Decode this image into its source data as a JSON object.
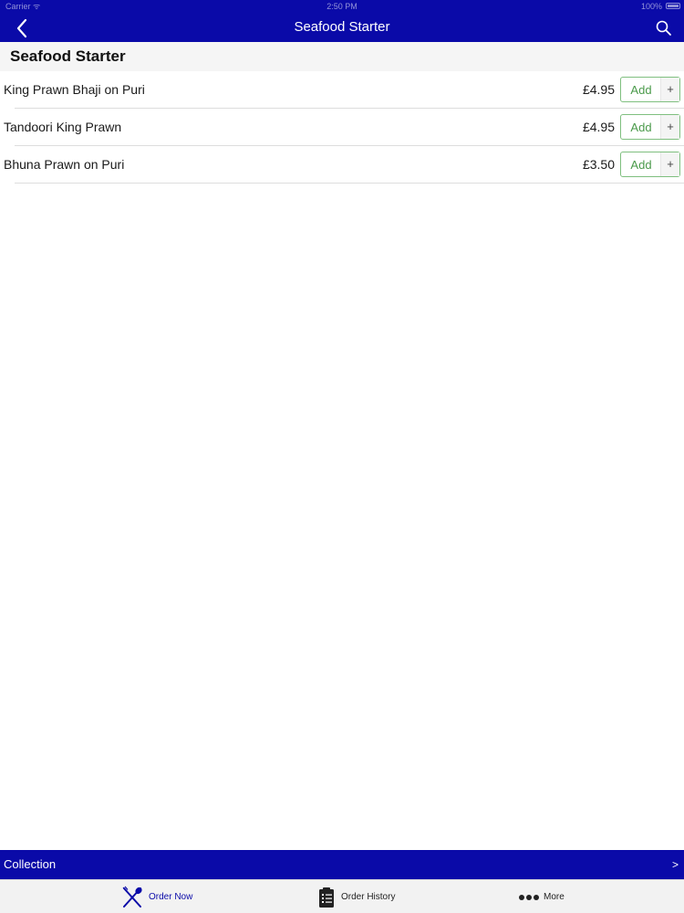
{
  "status_bar": {
    "carrier": "Carrier ᯤ",
    "time": "2:50 PM",
    "battery": "100%"
  },
  "nav": {
    "title": "Seafood Starter",
    "back_icon": "chevron-left-icon",
    "search_icon": "search-icon"
  },
  "section": {
    "title": "Seafood Starter"
  },
  "menu_items": [
    {
      "name": "King Prawn Bhaji on Puri",
      "price": "£4.95",
      "add_label": "Add",
      "plus": "+"
    },
    {
      "name": "Tandoori King Prawn",
      "price": "£4.95",
      "add_label": "Add",
      "plus": "+"
    },
    {
      "name": "Bhuna Prawn on Puri",
      "price": "£3.50",
      "add_label": "Add",
      "plus": "+"
    }
  ],
  "collection_bar": {
    "label": "Collection",
    "chevron": ">"
  },
  "tab_bar": {
    "tabs": [
      {
        "label": "Order Now",
        "icon": "fork-knife-icon",
        "active": true
      },
      {
        "label": "Order History",
        "icon": "clipboard-icon",
        "active": false
      },
      {
        "label": "More",
        "icon": "more-dots-icon",
        "active": false
      }
    ]
  },
  "colors": {
    "primary_blue": "#0a0aa8",
    "add_green": "#4a9a4a",
    "add_border": "#7fbf7f"
  }
}
